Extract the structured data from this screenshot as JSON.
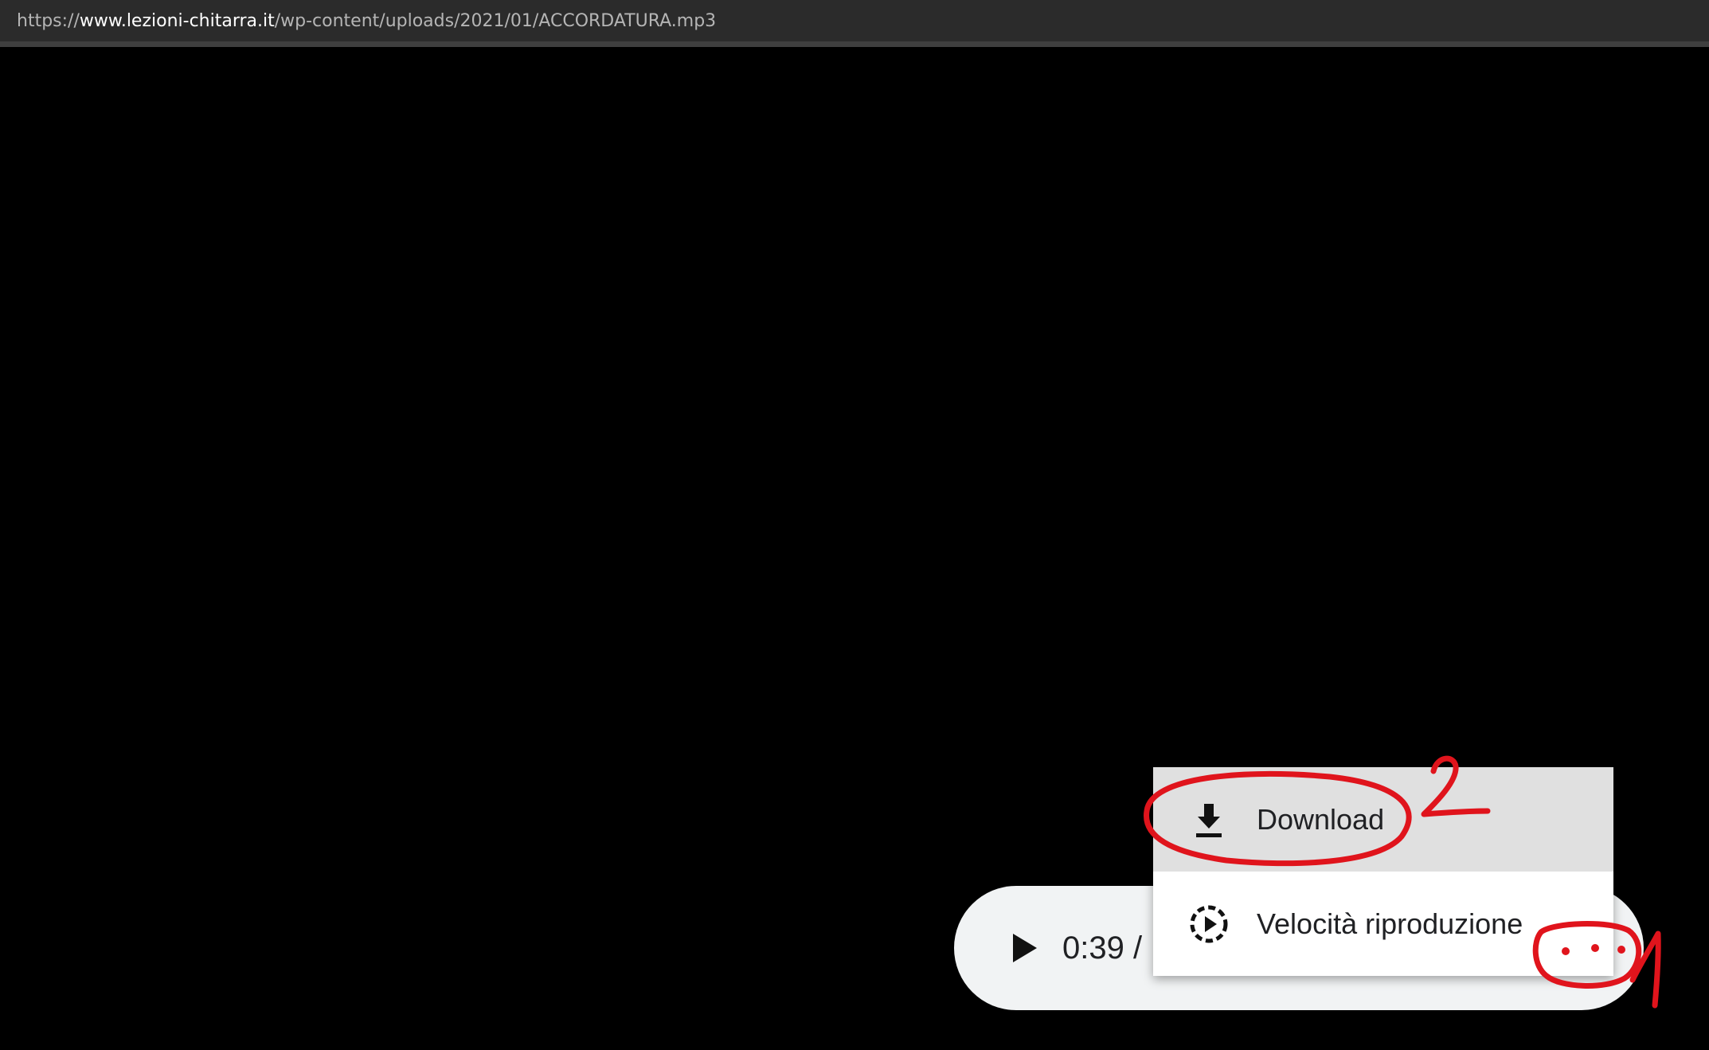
{
  "address_bar": {
    "scheme": "https://",
    "host": "www.lezioni-chitarra.it",
    "path": "/wp-content/uploads/2021/01/ACCORDATURA.mp3"
  },
  "audio_player": {
    "current_time": "0:39 /"
  },
  "overflow_menu": {
    "items": [
      {
        "label": "Download",
        "icon": "download-icon"
      },
      {
        "label": "Velocità riproduzione",
        "icon": "playback-speed-icon"
      }
    ]
  },
  "annotations": {
    "color": "#e0141c",
    "marks": [
      "2",
      "1"
    ]
  },
  "colors": {
    "page_background": "#000000",
    "urlbar_background": "#2b2b2b",
    "player_background": "#f1f3f4",
    "menu_hover": "#e0e0e0",
    "annotation_red": "#e0141c"
  }
}
